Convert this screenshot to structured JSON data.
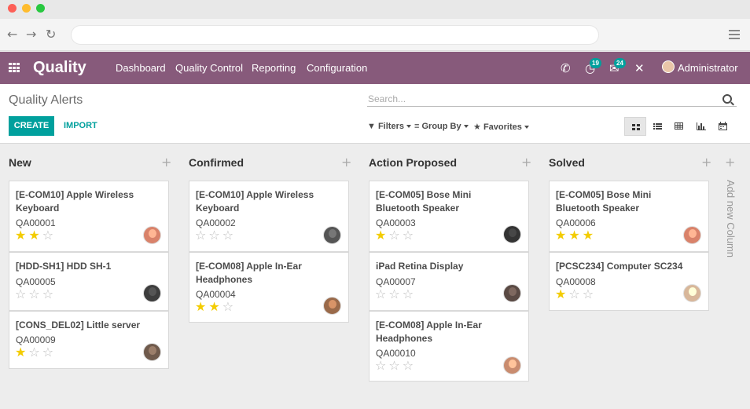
{
  "app": {
    "name": "Quality",
    "menus": [
      "Dashboard",
      "Quality Control",
      "Reporting",
      "Configuration"
    ],
    "notifications": {
      "activities": "19",
      "messages": "24"
    },
    "user": "Administrator",
    "brand_color": "#875a7b",
    "accent_color": "#00a09d"
  },
  "control": {
    "breadcrumb": "Quality Alerts",
    "search_placeholder": "Search...",
    "create_label": "CREATE",
    "import_label": "IMPORT",
    "filters_label": "Filters",
    "groupby_label": "Group By",
    "favorites_label": "Favorites",
    "views": [
      "kanban-view-icon",
      "list-view-icon",
      "pivot-view-icon",
      "graph-view-icon",
      "calendar-view-icon"
    ]
  },
  "kanban": {
    "add_column_label": "Add new Column",
    "columns": [
      {
        "title": "New",
        "cards": [
          {
            "title": "[E-COM10] Apple Wireless Keyboard",
            "ref": "QA00001",
            "stars": 2
          },
          {
            "title": "[HDD-SH1] HDD SH-1",
            "ref": "QA00005",
            "stars": 0
          },
          {
            "title": "[CONS_DEL02] Little server",
            "ref": "QA00009",
            "stars": 1
          }
        ]
      },
      {
        "title": "Confirmed",
        "cards": [
          {
            "title": "[E-COM10] Apple Wireless Keyboard",
            "ref": "QA00002",
            "stars": 0
          },
          {
            "title": "[E-COM08] Apple In-Ear Headphones",
            "ref": "QA00004",
            "stars": 2
          }
        ]
      },
      {
        "title": "Action Proposed",
        "cards": [
          {
            "title": "[E-COM05] Bose Mini Bluetooth Speaker",
            "ref": "QA00003",
            "stars": 1
          },
          {
            "title": "iPad Retina Display",
            "ref": "QA00007",
            "stars": 0
          },
          {
            "title": "[E-COM08] Apple In-Ear Headphones",
            "ref": "QA00010",
            "stars": 0
          }
        ]
      },
      {
        "title": "Solved",
        "cards": [
          {
            "title": "[E-COM05] Bose Mini Bluetooth Speaker",
            "ref": "QA00006",
            "stars": 3
          },
          {
            "title": "[PCSC234] Computer SC234",
            "ref": "QA00008",
            "stars": 1
          }
        ]
      }
    ]
  }
}
